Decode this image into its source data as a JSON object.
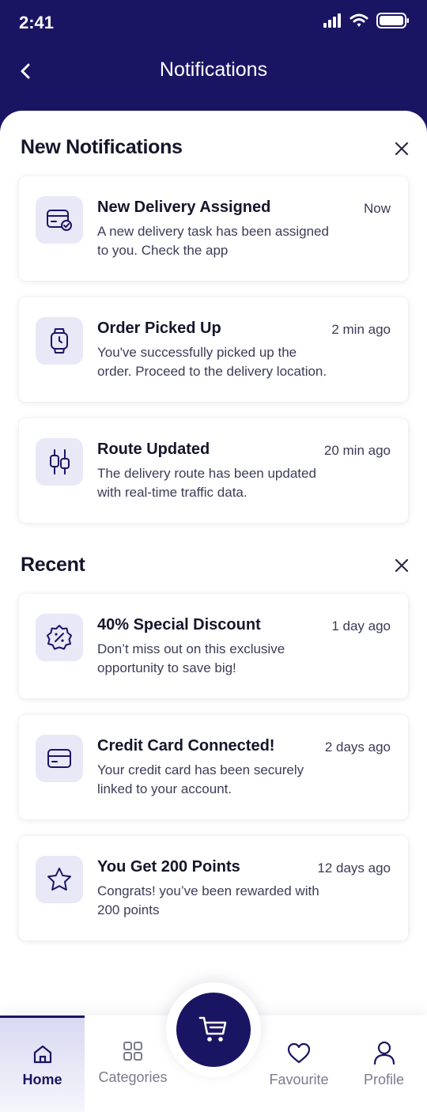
{
  "status_bar": {
    "time": "2:41"
  },
  "header": {
    "title": "Notifications"
  },
  "sections": {
    "new": {
      "title": "New Notifications"
    },
    "recent": {
      "title": "Recent"
    }
  },
  "new_notifications": [
    {
      "icon": "delivery-card-icon",
      "title": "New Delivery Assigned",
      "time": "Now",
      "body": "A new delivery task has been assigned to you. Check the app"
    },
    {
      "icon": "watch-icon",
      "title": "Order Picked Up",
      "time": "2 min ago",
      "body": "You've successfully picked up the order. Proceed to the delivery location."
    },
    {
      "icon": "route-icon",
      "title": "Route Updated",
      "time": "20 min ago",
      "body": "The delivery route has been updated with real-time traffic data."
    }
  ],
  "recent_notifications": [
    {
      "icon": "discount-icon",
      "title": "40% Special Discount",
      "time": "1 day ago",
      "body": "Don’t miss out on this exclusive opportunity to save big!"
    },
    {
      "icon": "credit-card-icon",
      "title": "Credit Card Connected!",
      "time": "2 days ago",
      "body": "Your credit card has been securely linked to your account."
    },
    {
      "icon": "star-icon",
      "title": "You Get 200 Points",
      "time": "12 days ago",
      "body": "Congrats! you’ve been rewarded with 200 points"
    }
  ],
  "bottom_nav": {
    "home": "Home",
    "categories": "Categories",
    "favourite": "Favourite",
    "profile": "Profile"
  },
  "colors": {
    "brand": "#1a1563",
    "icon_bg": "#e8e8f7",
    "text": "#15152b"
  }
}
